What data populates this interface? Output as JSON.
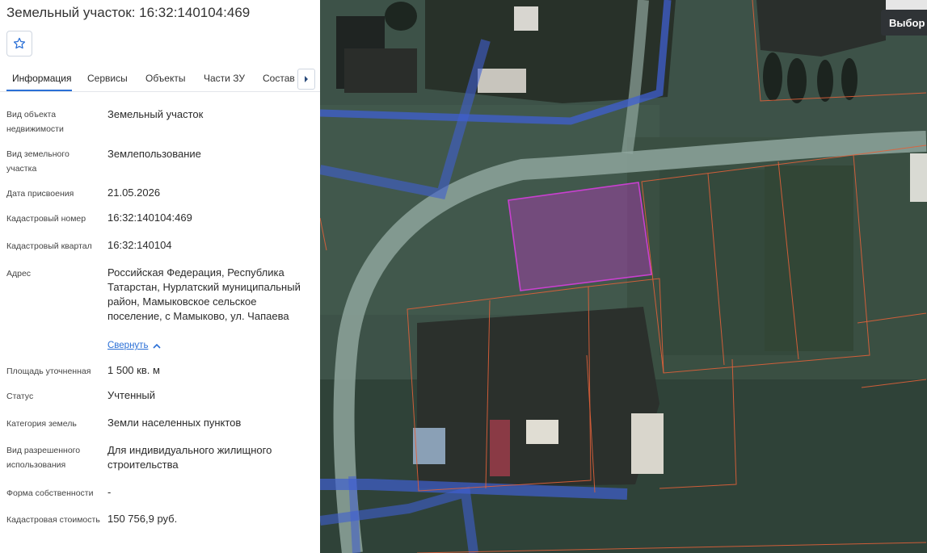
{
  "panel": {
    "title": "Земельный участок: 16:32:140104:469",
    "tabs": [
      {
        "label": "Информация"
      },
      {
        "label": "Сервисы"
      },
      {
        "label": "Объекты"
      },
      {
        "label": "Части ЗУ"
      },
      {
        "label": "Состав"
      }
    ],
    "fields": [
      {
        "label": "Вид объекта недвижимости",
        "value": "Земельный участок"
      },
      {
        "label": "Вид земельного участка",
        "value": "Землепользование"
      },
      {
        "label": "Дата присвоения",
        "value": "21.05.2026"
      },
      {
        "label": "Кадастровый номер",
        "value": "16:32:140104:469"
      },
      {
        "label": "Кадастровый квартал",
        "value": "16:32:140104"
      },
      {
        "label": "Адрес",
        "value": "Российская Федерация, Республика Татарстан, Нурлатский муниципальный район, Мамыковское сельское поселение, с Мамыково, ул. Чапаева"
      },
      {
        "label": "Площадь уточненная",
        "value": "1 500 кв. м"
      },
      {
        "label": "Статус",
        "value": "Учтенный"
      },
      {
        "label": "Категория земель",
        "value": "Земли населенных пунктов"
      },
      {
        "label": "Вид разрешенного использования",
        "value": "Для индивидуального жилищного строительства"
      },
      {
        "label": "Форма собственности",
        "value": "-"
      },
      {
        "label": "Кадастровая стоимость",
        "value": "150 756,9 руб."
      }
    ],
    "collapse_label": "Свернуть"
  },
  "map": {
    "basemap_button": "Выбор к",
    "colors": {
      "selected_parcel": "#b23bb8",
      "parcel_border": "#e0603a",
      "road": "#9fb4ad",
      "utility_line": "#3f5fd0"
    }
  },
  "icons": {
    "favorite": "star-outline-icon",
    "tabs_next": "caret-right-icon",
    "collapse": "chevron-up-icon"
  }
}
